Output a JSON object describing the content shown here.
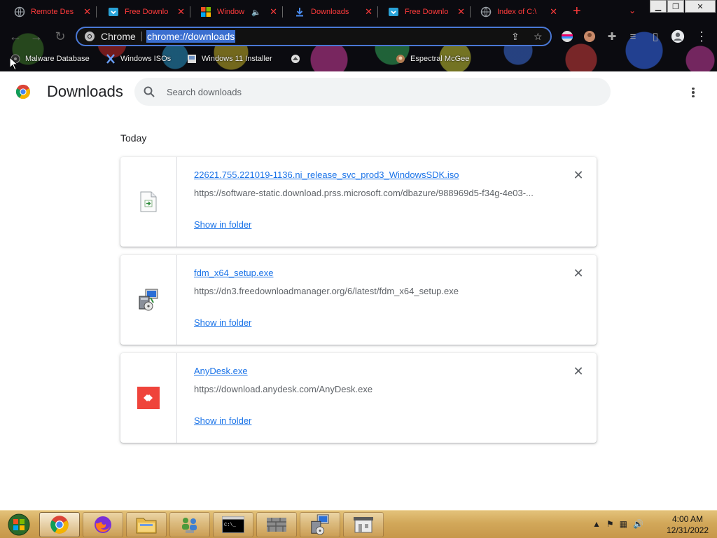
{
  "browser": {
    "tabs": [
      {
        "title": "Remote Des",
        "icon": "globe-icon"
      },
      {
        "title": "Free Downlo",
        "icon": "fdm-icon"
      },
      {
        "title": "Window",
        "icon": "windows-logo-icon",
        "muted_audio": true
      },
      {
        "title": "Downloads",
        "icon": "download-icon",
        "active": true
      },
      {
        "title": "Free Downlo",
        "icon": "fdm-icon"
      },
      {
        "title": "Index of C:\\",
        "icon": "globe-icon"
      }
    ],
    "new_tab_symbol": "+",
    "tab_search_symbol": "⌄",
    "window_controls": {
      "minimize": "▁",
      "restore": "❐",
      "close": "✕"
    },
    "omnibox": {
      "chip_label": "Chrome",
      "url": "chrome://downloads"
    },
    "bookmarks": [
      {
        "label": "Malware Database",
        "icon": "malware-db-icon"
      },
      {
        "label": "Windows ISOs",
        "icon": "x-logo-icon"
      },
      {
        "label": "Windows 11 Installer",
        "icon": "installer-icon"
      },
      {
        "label": "",
        "icon": "globe-icon"
      },
      {
        "label": "Espectral McGee",
        "icon": "profile-icon"
      }
    ],
    "accent_color": "#ff3b3b"
  },
  "page": {
    "title": "Downloads",
    "search": {
      "placeholder": "Search downloads"
    },
    "section": "Today",
    "downloads": [
      {
        "file_name": "22621.755.221019-1136.ni_release_svc_prod3_WindowsSDK.iso",
        "url": "https://software-static.download.prss.microsoft.com/dbazure/988969d5-f34g-4e03-...",
        "action": "Show in folder",
        "remove": "✕",
        "icon": "iso-file-icon"
      },
      {
        "file_name": "fdm_x64_setup.exe",
        "url": "https://dn3.freedownloadmanager.org/6/latest/fdm_x64_setup.exe",
        "action": "Show in folder",
        "remove": "✕",
        "icon": "installer-file-icon"
      },
      {
        "file_name": "AnyDesk.exe",
        "url": "https://download.anydesk.com/AnyDesk.exe",
        "action": "Show in folder",
        "remove": "✕",
        "icon": "anydesk-icon"
      }
    ],
    "link_color": "#1a73e8"
  },
  "taskbar": {
    "apps": [
      "chrome-icon",
      "firefox-icon",
      "file-explorer-icon",
      "network-users-icon",
      "command-prompt-icon",
      "firewall-icon",
      "installer-icon",
      "store-icon"
    ],
    "cmd_text": "C:\\_",
    "clock": {
      "time": "4:00 AM",
      "date": "12/31/2022"
    }
  }
}
